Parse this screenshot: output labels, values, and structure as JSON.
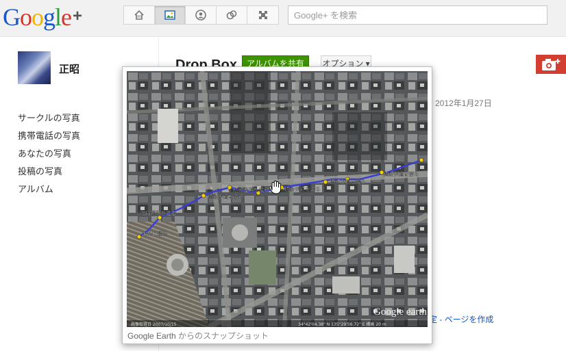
{
  "header": {
    "logo_text": "Google",
    "logo_plus": "+",
    "nav": [
      {
        "name": "home-icon"
      },
      {
        "name": "photos-icon",
        "active": true
      },
      {
        "name": "profile-icon"
      },
      {
        "name": "circles-icon"
      },
      {
        "name": "games-icon"
      }
    ],
    "search_placeholder": "Google+ を検索"
  },
  "sidebar": {
    "username": "正昭",
    "items": [
      {
        "label": "サークルの写真"
      },
      {
        "label": "携帯電話の写真"
      },
      {
        "label": "あなたの写真"
      },
      {
        "label": "投稿の写真"
      },
      {
        "label": "アルバム"
      }
    ]
  },
  "album": {
    "title": "Drop Box",
    "share_label": "アルバムを共有",
    "options_label": "オプション ▾",
    "date": "2012年1月27日",
    "footer_link": "定 - ページを作成"
  },
  "popup": {
    "caption_strong": "Google Earth",
    "caption_rest": " からのスナップショット",
    "map_labels": [
      "横断歩道を渡る",
      "横断歩道を渡る",
      "横断歩道を渡る",
      "横断歩道を渡る",
      "横断歩道を渡る",
      "階段通路を進む",
      "出札口通路",
      "Google earth"
    ]
  },
  "colors": {
    "share_green": "#3d9400",
    "camera_red": "#d23f31",
    "link_blue": "#1155cc"
  }
}
